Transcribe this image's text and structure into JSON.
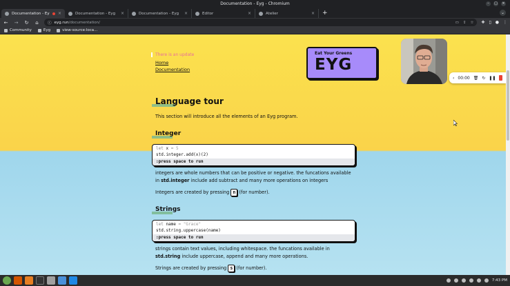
{
  "window": {
    "title": "Documentation - Eyg - Chromium"
  },
  "tabs": [
    {
      "title": "Documentation - Eyg",
      "active": true,
      "recording": true
    },
    {
      "title": "Documentation - Eyg",
      "active": false
    },
    {
      "title": "Documentation - Eyg",
      "active": false
    },
    {
      "title": "Editor",
      "active": false
    },
    {
      "title": "Atelier",
      "active": false
    }
  ],
  "toolbar": {
    "url_host": "eyg.run",
    "url_path": "/documentation/",
    "back_icon": "back-arrow-icon",
    "forward_icon": "forward-arrow-icon",
    "reload_icon": "reload-icon",
    "home_icon": "home-icon"
  },
  "bookmarks": [
    "Community",
    "Eyg",
    "view-source:loca..."
  ],
  "page": {
    "notice": "There is an update",
    "nav": [
      "Home",
      "Documentation"
    ],
    "logo": {
      "tag": "Eat Your Greens",
      "brand": "EYG"
    },
    "player": {
      "time": "00:00"
    },
    "heading": "Language tour",
    "intro": "This section will introduce all the elements of an Eyg program.",
    "sections": [
      {
        "title": "Integer",
        "code_lines": [
          "let x = 5",
          "std.integer.add(x)(2)"
        ],
        "run_hint": ":press space to run",
        "desc_pre": "integers are whole numbers that can be positive or negative. the funcations available in ",
        "desc_bold": "std.integer",
        "desc_post": " include add subtract and many more operations on integers",
        "create_pre": "Integers are created by pressing ",
        "create_key": "n",
        "create_post": " (for number)."
      },
      {
        "title": "Strings",
        "code_lines": [
          "let name = \"Grace\"",
          "std.string.uppercase(name)"
        ],
        "run_hint": ":press space to run",
        "desc_pre": "strings contain text values, including whitespace. the funcations available in ",
        "desc_bold": "std.string",
        "desc_post": " include uppercase, append and many more operations.",
        "create_pre": "Strings are created by pressing ",
        "create_key": "s",
        "create_post": " (for number)."
      }
    ]
  },
  "taskbar": {
    "time": "7:43 PM"
  },
  "colors": {
    "page_top": "#fbe24e",
    "page_bottom": "#b6e2f1",
    "logo": "#a78bfa",
    "accent_mark": "#7bb98f"
  }
}
